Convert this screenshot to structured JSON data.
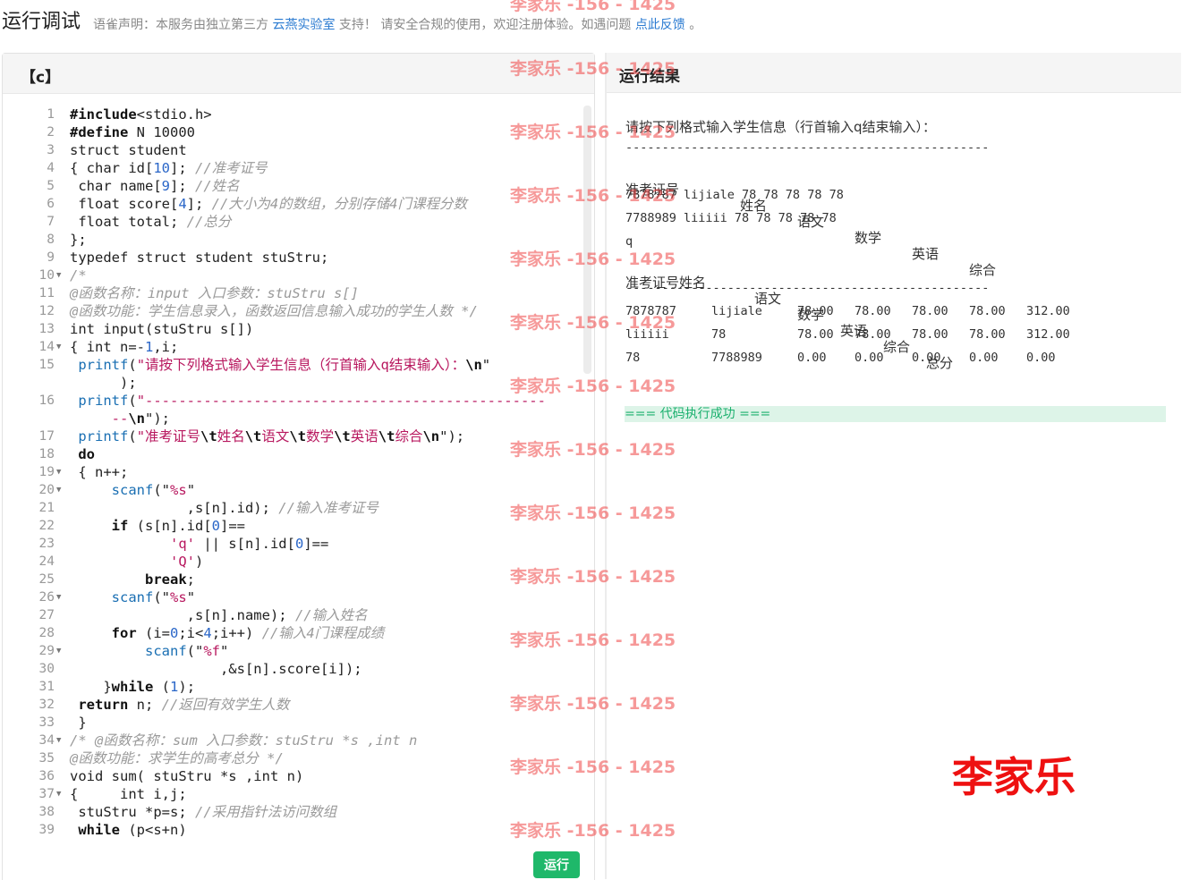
{
  "header": {
    "title": "运行调试",
    "disclaimer_prefix": "语雀声明：本服务由独立第三方",
    "provider_link": "云燕实验室",
    "disclaimer_middle": "支持！ 请安全合规的使用，欢迎注册体验。如遇问题",
    "feedback_link": "点此反馈",
    "disclaimer_suffix": "。"
  },
  "editor": {
    "language": "【c】",
    "run_label": "运行"
  },
  "result": {
    "title": "运行结果",
    "prompt": "请按下列格式输入学生信息（行首输入q结束输入）：",
    "separator": "--------------------------------------------------",
    "input_headers": [
      "准考证号",
      "姓名",
      "语文",
      "数学",
      "英语",
      "综合"
    ],
    "input_lines": [
      "7878787 lijiale 78 78 78 78 78",
      "7788989 liiiii 78 78 78 78 78",
      "q"
    ],
    "output_header_1": "准考证号姓名",
    "output_headers": [
      "语文",
      "数学",
      "英语",
      "综合",
      "总分"
    ],
    "rows": [
      [
        "7878787",
        "lijiale",
        "78.00",
        "78.00",
        "78.00",
        "78.00",
        "312.00"
      ],
      [
        "liiiii",
        "78",
        "78.00",
        "78.00",
        "78.00",
        "78.00",
        "312.00"
      ],
      [
        "78",
        "7788989",
        "0.00",
        "0.00",
        "0.00",
        "0.00",
        "0.00"
      ]
    ],
    "success": "=== 代码执行成功 ==="
  },
  "watermark": {
    "text": "李家乐 -156 - 1425",
    "signature": "李家乐"
  },
  "code_lines": [
    {
      "n": "1",
      "fold": false,
      "h": [
        [
          "kw",
          "#include"
        ],
        [
          "",
          "<stdio.h>"
        ]
      ]
    },
    {
      "n": "2",
      "fold": false,
      "h": [
        [
          "kw",
          "#define"
        ],
        [
          "",
          " N 10000"
        ]
      ]
    },
    {
      "n": "3",
      "fold": false,
      "h": [
        [
          "",
          "struct student"
        ]
      ]
    },
    {
      "n": "4",
      "fold": false,
      "h": [
        [
          "",
          "{ char id["
        ],
        [
          "num",
          "10"
        ],
        [
          "",
          "]; "
        ],
        [
          "cm",
          "//准考证号"
        ]
      ]
    },
    {
      "n": "5",
      "fold": false,
      "h": [
        [
          "",
          " char name["
        ],
        [
          "num",
          "9"
        ],
        [
          "",
          "]; "
        ],
        [
          "cm",
          "//姓名"
        ]
      ]
    },
    {
      "n": "6",
      "fold": false,
      "h": [
        [
          "",
          " float score["
        ],
        [
          "num",
          "4"
        ],
        [
          "",
          "]; "
        ],
        [
          "cm",
          "//大小为4的数组，分别存储4门课程分数"
        ]
      ]
    },
    {
      "n": "7",
      "fold": false,
      "h": [
        [
          "",
          " float total; "
        ],
        [
          "cm",
          "//总分"
        ]
      ]
    },
    {
      "n": "8",
      "fold": false,
      "h": [
        [
          "",
          "};"
        ]
      ]
    },
    {
      "n": "9",
      "fold": false,
      "h": [
        [
          "",
          "typedef struct student stuStru;"
        ]
      ]
    },
    {
      "n": "10",
      "fold": true,
      "h": [
        [
          "cm",
          "/*"
        ]
      ]
    },
    {
      "n": "11",
      "fold": false,
      "h": [
        [
          "cm",
          "@函数名称：input 入口参数：stuStru s[]"
        ]
      ]
    },
    {
      "n": "12",
      "fold": false,
      "h": [
        [
          "cm",
          "@函数功能：学生信息录入，函数返回信息输入成功的学生人数 */"
        ]
      ]
    },
    {
      "n": "13",
      "fold": false,
      "h": [
        [
          "",
          "int input(stuStru s[])"
        ]
      ]
    },
    {
      "n": "14",
      "fold": true,
      "h": [
        [
          "",
          "{ int n=-"
        ],
        [
          "num",
          "1"
        ],
        [
          "",
          ",i;"
        ]
      ]
    },
    {
      "n": "15",
      "fold": false,
      "h": [
        [
          "",
          " "
        ],
        [
          "fn",
          "printf"
        ],
        [
          "",
          "("
        ],
        [
          "str",
          "\"请按下列格式输入学生信息（行首输入q结束输入）："
        ],
        [
          "kw",
          "\\n"
        ],
        [
          "",
          "\""
        ]
      ]
    },
    {
      "n": "",
      "fold": false,
      "h": [
        [
          "",
          "      );"
        ]
      ]
    },
    {
      "n": "16",
      "fold": false,
      "h": [
        [
          "",
          " "
        ],
        [
          "fn",
          "printf"
        ],
        [
          "",
          "("
        ],
        [
          "str",
          "\"------------------------------------------------"
        ]
      ]
    },
    {
      "n": "",
      "fold": false,
      "h": [
        [
          "str",
          "     --"
        ],
        [
          "kw",
          "\\n"
        ],
        [
          "",
          "\");"
        ]
      ]
    },
    {
      "n": "17",
      "fold": false,
      "h": [
        [
          "",
          " "
        ],
        [
          "fn",
          "printf"
        ],
        [
          "",
          "("
        ],
        [
          "str",
          "\"准考证号"
        ],
        [
          "kw",
          "\\t"
        ],
        [
          "str",
          "姓名"
        ],
        [
          "kw",
          "\\t"
        ],
        [
          "str",
          "语文"
        ],
        [
          "kw",
          "\\t"
        ],
        [
          "str",
          "数学"
        ],
        [
          "kw",
          "\\t"
        ],
        [
          "str",
          "英语"
        ],
        [
          "kw",
          "\\t"
        ],
        [
          "str",
          "综合"
        ],
        [
          "kw",
          "\\n"
        ],
        [
          "",
          "\");"
        ]
      ]
    },
    {
      "n": "18",
      "fold": false,
      "h": [
        [
          "",
          " "
        ],
        [
          "kw",
          "do"
        ]
      ]
    },
    {
      "n": "19",
      "fold": true,
      "h": [
        [
          "",
          " { n++;"
        ]
      ]
    },
    {
      "n": "20",
      "fold": true,
      "h": [
        [
          "",
          "     "
        ],
        [
          "fn",
          "scanf"
        ],
        [
          "",
          "(\""
        ],
        [
          "str",
          "%s"
        ],
        [
          "",
          "\""
        ]
      ]
    },
    {
      "n": "21",
      "fold": false,
      "h": [
        [
          "",
          "              ,s[n].id); "
        ],
        [
          "cm",
          "//输入准考证号"
        ]
      ]
    },
    {
      "n": "22",
      "fold": false,
      "h": [
        [
          "",
          "     "
        ],
        [
          "kw",
          "if"
        ],
        [
          "",
          " (s[n].id["
        ],
        [
          "num",
          "0"
        ],
        [
          "",
          "]=="
        ]
      ]
    },
    {
      "n": "23",
      "fold": false,
      "h": [
        [
          "",
          "            "
        ],
        [
          "str",
          "'q'"
        ],
        [
          "",
          " || s[n].id["
        ],
        [
          "num",
          "0"
        ],
        [
          "",
          "]=="
        ]
      ]
    },
    {
      "n": "24",
      "fold": false,
      "h": [
        [
          "",
          "            "
        ],
        [
          "str",
          "'Q'"
        ],
        [
          "",
          ")"
        ]
      ]
    },
    {
      "n": "25",
      "fold": false,
      "h": [
        [
          "",
          "         "
        ],
        [
          "kw",
          "break"
        ],
        [
          "",
          ";"
        ]
      ]
    },
    {
      "n": "26",
      "fold": true,
      "h": [
        [
          "",
          "     "
        ],
        [
          "fn",
          "scanf"
        ],
        [
          "",
          "(\""
        ],
        [
          "str",
          "%s"
        ],
        [
          "",
          "\""
        ]
      ]
    },
    {
      "n": "27",
      "fold": false,
      "h": [
        [
          "",
          "              ,s[n].name); "
        ],
        [
          "cm",
          "//输入姓名"
        ]
      ]
    },
    {
      "n": "28",
      "fold": false,
      "h": [
        [
          "",
          "     "
        ],
        [
          "kw",
          "for"
        ],
        [
          "",
          " (i="
        ],
        [
          "num",
          "0"
        ],
        [
          "",
          ";i<"
        ],
        [
          "num",
          "4"
        ],
        [
          "",
          ";i++) "
        ],
        [
          "cm",
          "//输入4门课程成绩"
        ]
      ]
    },
    {
      "n": "29",
      "fold": true,
      "h": [
        [
          "",
          "         "
        ],
        [
          "fn",
          "scanf"
        ],
        [
          "",
          "(\""
        ],
        [
          "str",
          "%f"
        ],
        [
          "",
          "\""
        ]
      ]
    },
    {
      "n": "30",
      "fold": false,
      "h": [
        [
          "",
          "                  ,&s[n].score[i]);"
        ]
      ]
    },
    {
      "n": "31",
      "fold": false,
      "h": [
        [
          "",
          "    }"
        ],
        [
          "kw",
          "while"
        ],
        [
          "",
          " ("
        ],
        [
          "num",
          "1"
        ],
        [
          "",
          ");"
        ]
      ]
    },
    {
      "n": "32",
      "fold": false,
      "h": [
        [
          "",
          " "
        ],
        [
          "kw",
          "return"
        ],
        [
          "",
          " n; "
        ],
        [
          "cm",
          "//返回有效学生人数"
        ]
      ]
    },
    {
      "n": "33",
      "fold": false,
      "h": [
        [
          "",
          " }"
        ]
      ]
    },
    {
      "n": "34",
      "fold": true,
      "h": [
        [
          "cm",
          "/* @函数名称：sum 入口参数：stuStru *s ,int n"
        ]
      ]
    },
    {
      "n": "35",
      "fold": false,
      "h": [
        [
          "cm",
          "@函数功能：求学生的高考总分 */"
        ]
      ]
    },
    {
      "n": "36",
      "fold": false,
      "h": [
        [
          "",
          "void sum( stuStru *s ,int n)"
        ]
      ]
    },
    {
      "n": "37",
      "fold": true,
      "h": [
        [
          "",
          "{     int i,j;"
        ]
      ]
    },
    {
      "n": "38",
      "fold": false,
      "h": [
        [
          "",
          " stuStru *p=s; "
        ],
        [
          "cm",
          "//采用指针法访问数组"
        ]
      ]
    },
    {
      "n": "39",
      "fold": false,
      "h": [
        [
          "",
          " "
        ],
        [
          "kw",
          "while"
        ],
        [
          "",
          " (p<s+n)"
        ]
      ]
    }
  ]
}
